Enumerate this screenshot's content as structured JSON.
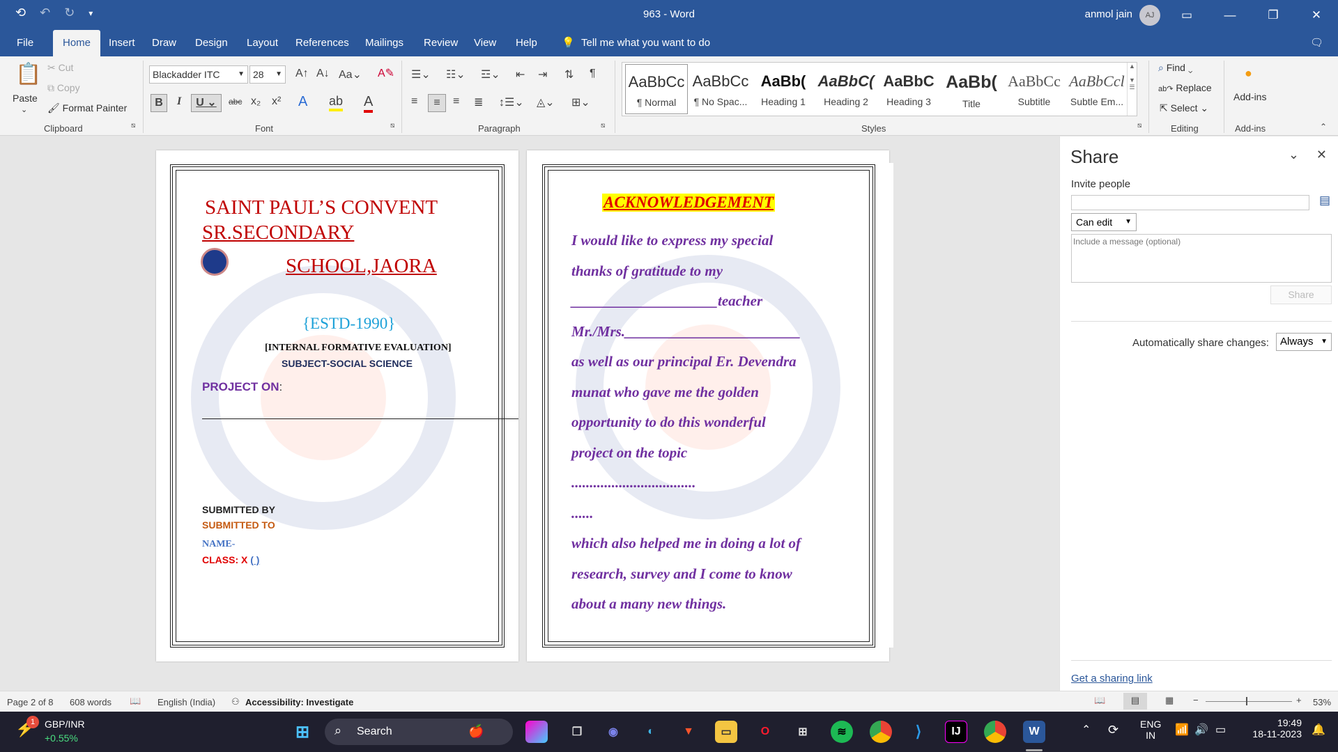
{
  "window": {
    "title": "963 - Word",
    "user": "anmol jain",
    "user_initials": "AJ"
  },
  "tabs": [
    "File",
    "Home",
    "Insert",
    "Draw",
    "Design",
    "Layout",
    "References",
    "Mailings",
    "Review",
    "View",
    "Help"
  ],
  "tell_me": "Tell me what you want to do",
  "clipboard": {
    "paste": "Paste",
    "cut": "Cut",
    "copy": "Copy",
    "format_painter": "Format Painter",
    "label": "Clipboard"
  },
  "font": {
    "name": "Blackadder ITC",
    "size": "28",
    "label": "Font",
    "case_btn": "Aa"
  },
  "paragraph": {
    "label": "Paragraph"
  },
  "styles": {
    "label": "Styles",
    "items": [
      {
        "preview": "AaBbCc",
        "name": "¶ Normal"
      },
      {
        "preview": "AaBbCc",
        "name": "¶ No Spac..."
      },
      {
        "preview": "AaBb(",
        "name": "Heading 1"
      },
      {
        "preview": "AaBbC(",
        "name": "Heading 2"
      },
      {
        "preview": "AaBbC",
        "name": "Heading 3"
      },
      {
        "preview": "AaBb(",
        "name": "Title"
      },
      {
        "preview": "AaBbCc",
        "name": "Subtitle"
      },
      {
        "preview": "AaBbCcl",
        "name": "Subtle Em..."
      }
    ]
  },
  "editing": {
    "find": "Find",
    "replace": "Replace",
    "select": "Select",
    "label": "Editing"
  },
  "addins": {
    "button": "Add-ins",
    "label": "Add-ins"
  },
  "page1": {
    "school_line1": "SAINT PAUL’S CONVENT",
    "school_line2": "SR.SECONDARY",
    "school_line3": "SCHOOL,JAORA",
    "estd": "{ESTD-1990}",
    "evaluation": "[INTERNAL FORMATIVE EVALUATION]",
    "subject": "SUBJECT-SOCIAL SCIENCE",
    "project_on": "PROJECT ON",
    "project_colon": ":",
    "submitted_by": "SUBMITTED BY",
    "submitted_to": "SUBMITTED TO",
    "name": "NAME-",
    "class_label": "CLASS: X",
    "class_value": "( )"
  },
  "page2": {
    "heading": "ACKNOWLEDGEMENT",
    "lines": [
      "I would like to express my special",
      "thanks of gratitude to my",
      "____________________teacher",
      "Mr./Mrs.________________________",
      "as well as our principal Er. Devendra",
      "munat who gave me the golden",
      "opportunity to do this wonderful",
      "project on the topic",
      "..................................",
      "......",
      "which also helped me in doing a lot of",
      "research, survey and I come to know",
      "about a many new things."
    ]
  },
  "share": {
    "title": "Share",
    "invite_label": "Invite people",
    "permission": "Can edit",
    "message_placeholder": "Include a message (optional)",
    "share_button": "Share",
    "auto_label": "Automatically share changes:",
    "auto_value": "Always",
    "link": "Get a sharing link"
  },
  "status": {
    "page": "Page 2 of 8",
    "words": "608 words",
    "language": "English (India)",
    "accessibility": "Accessibility: Investigate",
    "zoom": "53%"
  },
  "taskbar": {
    "ticker_name": "GBP/INR",
    "ticker_change": "+0.55%",
    "ticker_badge": "1",
    "search": "Search",
    "lang1": "ENG",
    "lang2": "IN",
    "time": "19:49",
    "date": "18-11-2023"
  }
}
